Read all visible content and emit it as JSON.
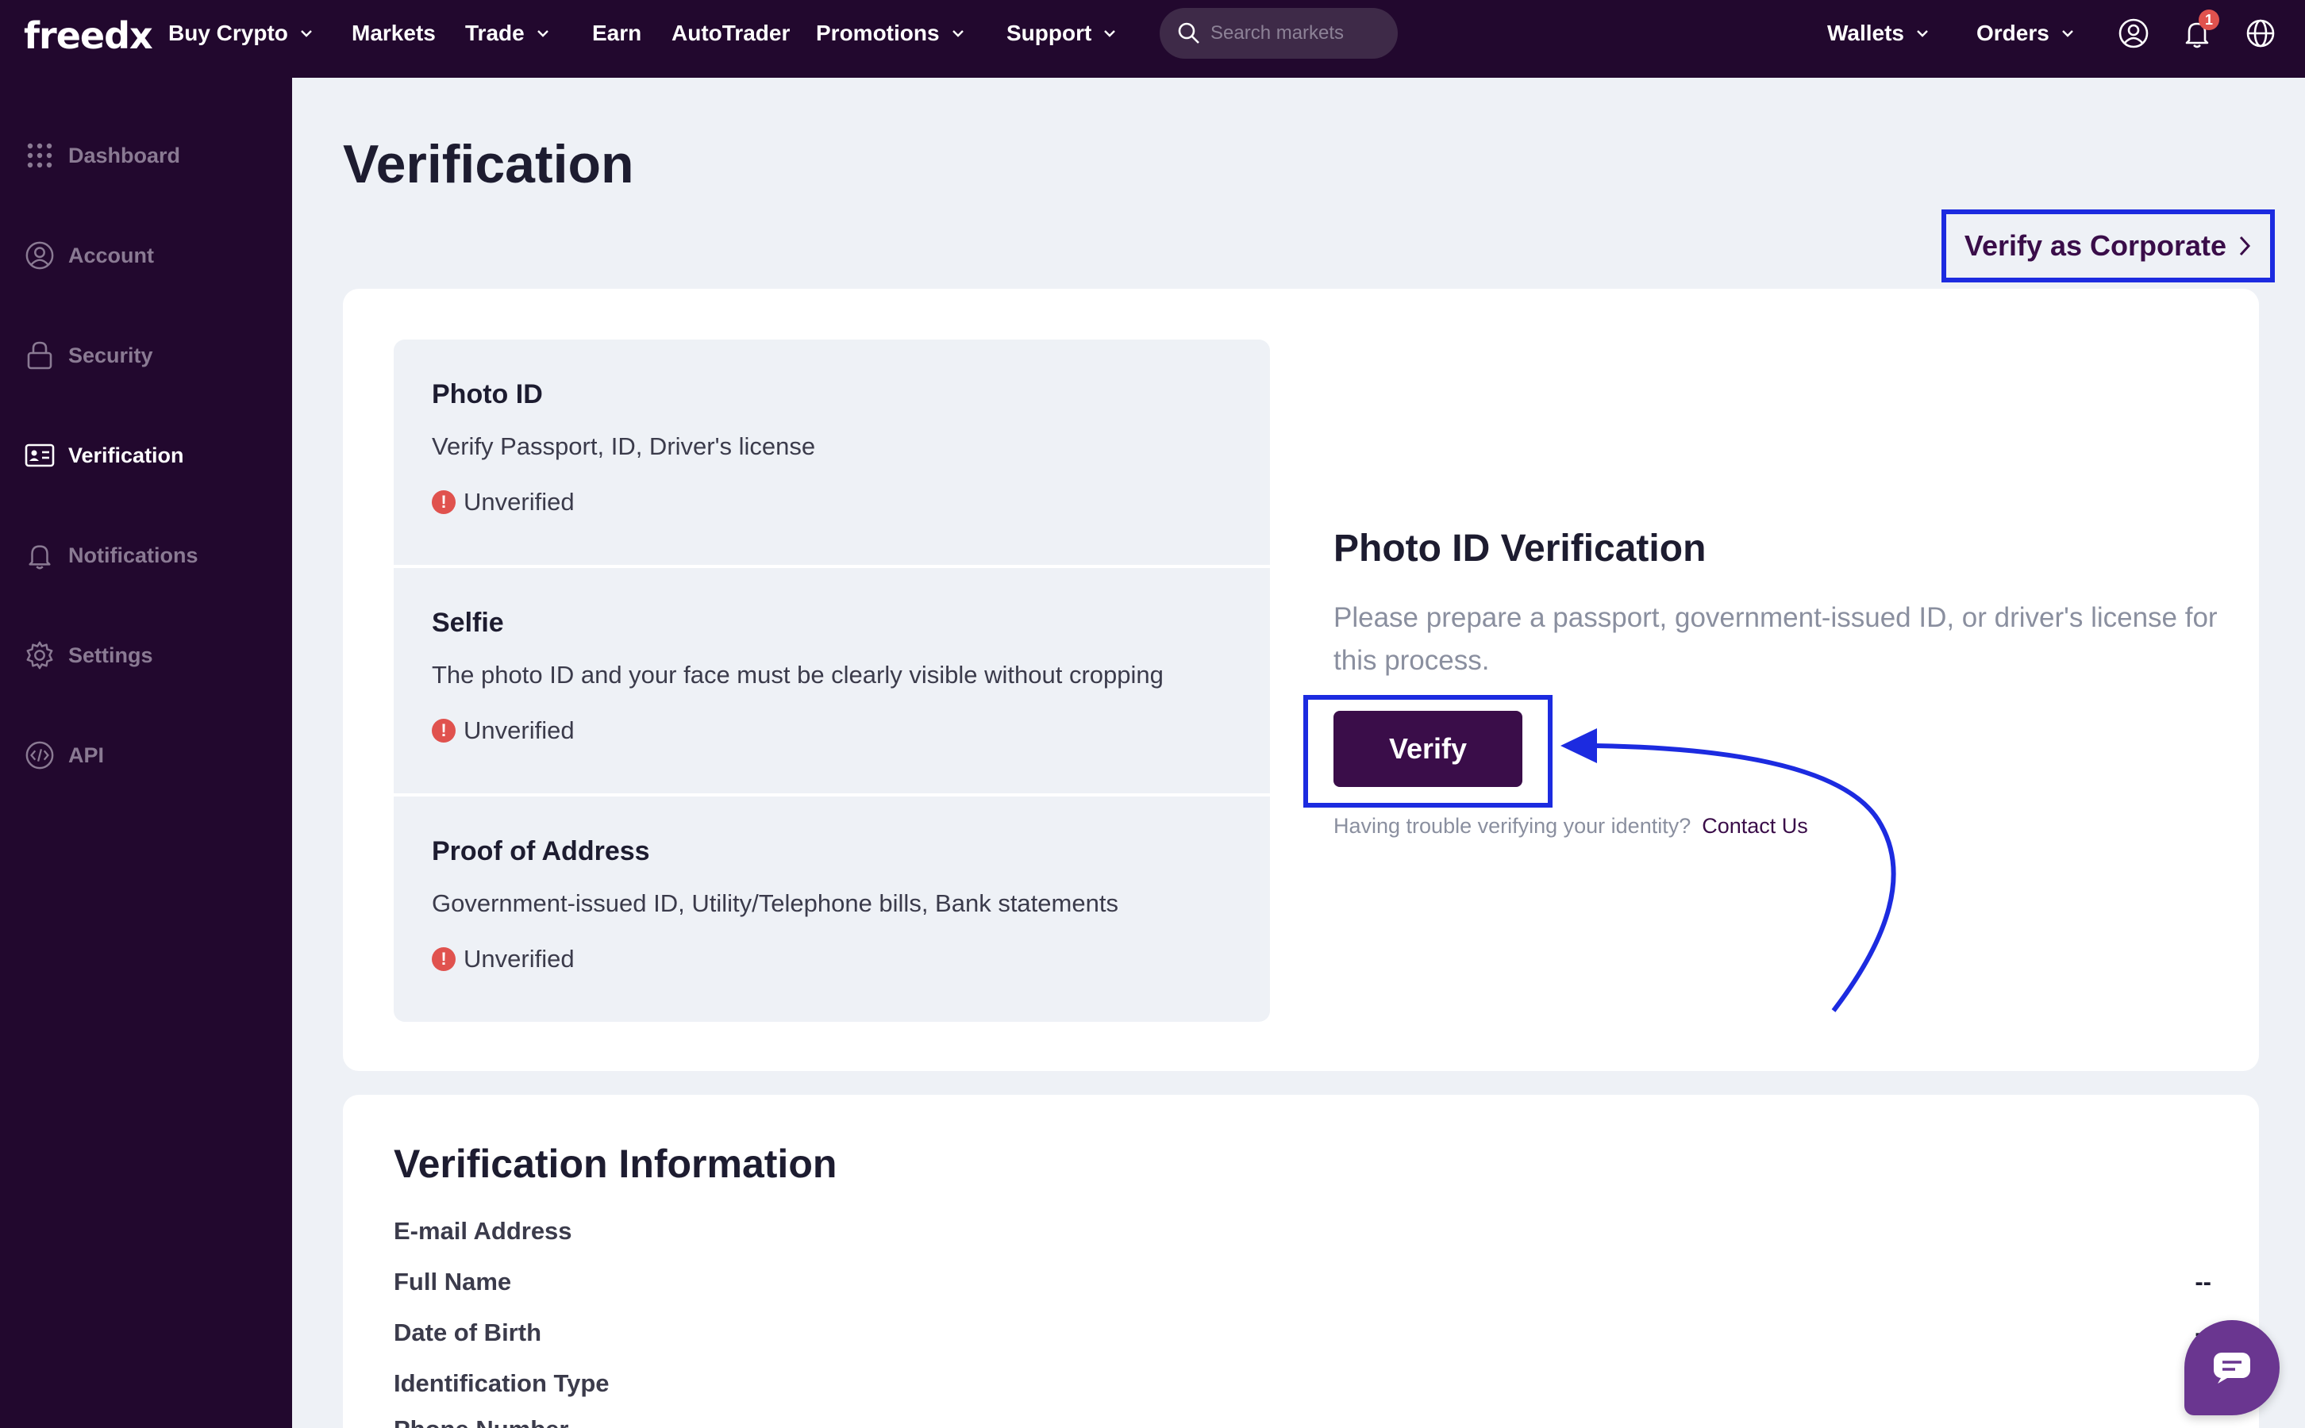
{
  "nav": {
    "logo": "freedx",
    "items": [
      {
        "label": "Buy Crypto",
        "dropdown": true
      },
      {
        "label": "Markets",
        "dropdown": false
      },
      {
        "label": "Trade",
        "dropdown": true
      },
      {
        "label": "Earn",
        "dropdown": false
      },
      {
        "label": "AutoTrader",
        "dropdown": false
      },
      {
        "label": "Promotions",
        "dropdown": true
      },
      {
        "label": "Support",
        "dropdown": true
      }
    ],
    "search_placeholder": "Search markets",
    "wallets_label": "Wallets",
    "orders_label": "Orders",
    "notification_count": "1",
    "icons": [
      "search-icon",
      "user-circle-icon",
      "bell-icon",
      "globe-icon",
      "chevron-down-icon"
    ]
  },
  "sidebar": {
    "items": [
      {
        "label": "Dashboard",
        "icon": "grid-dots-icon",
        "active": false
      },
      {
        "label": "Account",
        "icon": "user-circle-icon",
        "active": false
      },
      {
        "label": "Security",
        "icon": "lock-icon",
        "active": false
      },
      {
        "label": "Verification",
        "icon": "id-card-icon",
        "active": true
      },
      {
        "label": "Notifications",
        "icon": "bell-icon",
        "active": false
      },
      {
        "label": "Settings",
        "icon": "gear-icon",
        "active": false
      },
      {
        "label": "API",
        "icon": "code-icon",
        "active": false
      }
    ]
  },
  "main": {
    "title": "Verification",
    "corporate_link": "Verify as Corporate",
    "steps": [
      {
        "title": "Photo ID",
        "description": "Verify Passport, ID, Driver's license",
        "status": "Unverified"
      },
      {
        "title": "Selfie",
        "description": "The photo ID and your face must be clearly visible without cropping",
        "status": "Unverified"
      },
      {
        "title": "Proof of Address",
        "description": "Government-issued ID, Utility/Telephone bills, Bank statements",
        "status": "Unverified"
      }
    ],
    "photo_verification": {
      "title": "Photo ID Verification",
      "description": "Please prepare a passport, government-issued ID, or driver's license for this process.",
      "verify_label": "Verify",
      "trouble_text": "Having trouble verifying your identity?",
      "contact_label": "Contact Us"
    },
    "verification_info": {
      "title": "Verification Information",
      "rows": [
        {
          "label": "E-mail Address",
          "value": ""
        },
        {
          "label": "Full Name",
          "value": "--"
        },
        {
          "label": "Date of Birth",
          "value": "--"
        },
        {
          "label": "Identification Type",
          "value": ""
        },
        {
          "label": "Phone Number",
          "value": ""
        }
      ]
    }
  },
  "colors": {
    "nav_bg": "#22082e",
    "accent": "#3a0d49",
    "highlight": "#1c2be0",
    "warning": "#e0524e",
    "page_bg": "#eef1f6"
  }
}
